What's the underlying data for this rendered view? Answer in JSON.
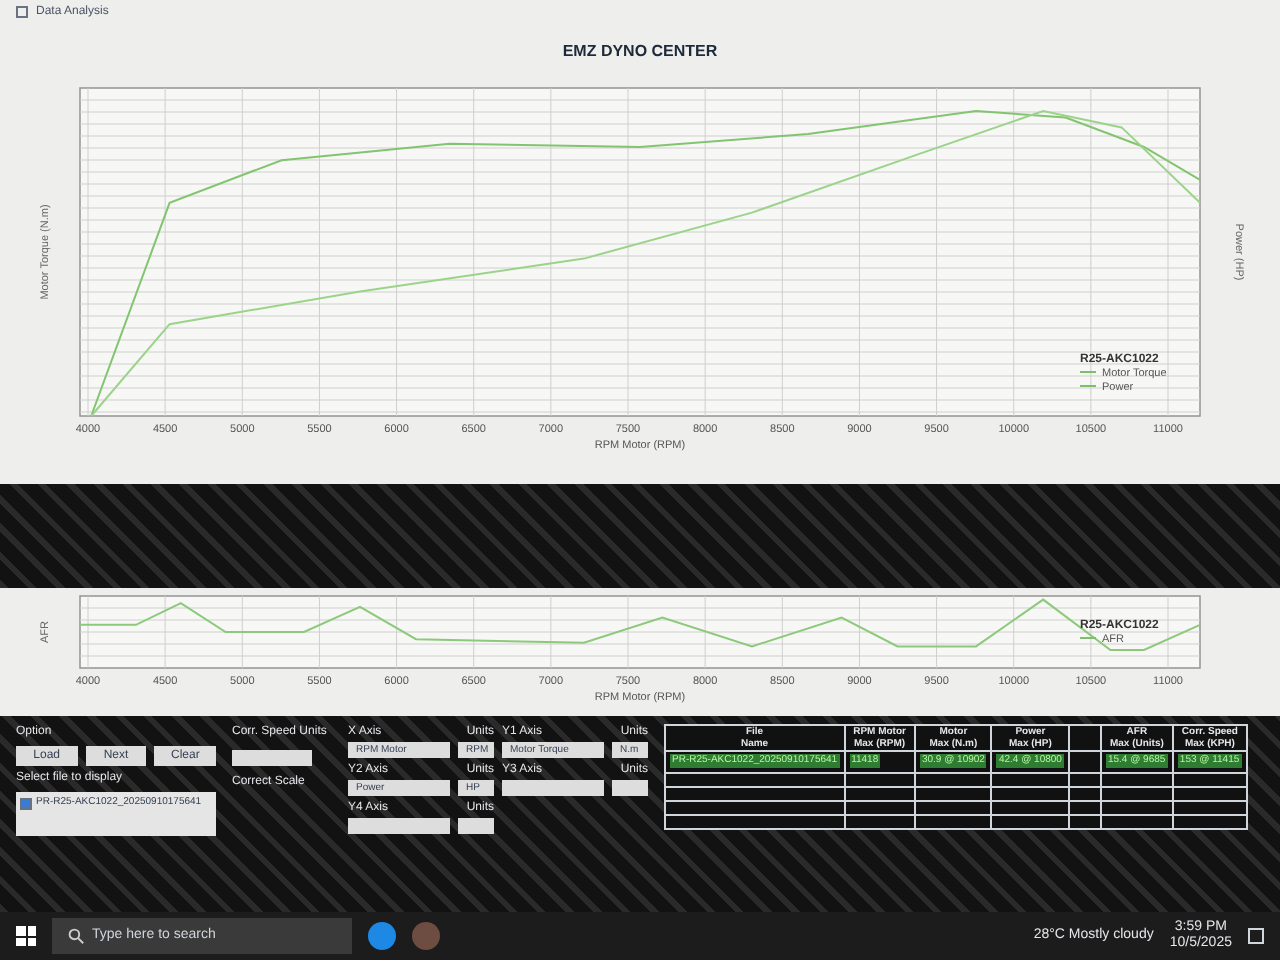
{
  "window": {
    "title": "Data Analysis"
  },
  "main_chart": {
    "title": "EMZ DYNO CENTER",
    "xlabel": "RPM Motor (RPM)",
    "y1label": "Motor Torque (N.m)",
    "y2label": "Power (HP)",
    "x_tick_labels": [
      "4000",
      "4500",
      "5000",
      "5500",
      "6000",
      "6500",
      "7000",
      "7500",
      "8000",
      "8500",
      "9000",
      "9500",
      "10000",
      "10500",
      "11000"
    ],
    "legend": {
      "title": "R25-AKC1022",
      "series": [
        "Motor Torque",
        "Power"
      ]
    }
  },
  "afr_chart": {
    "xlabel": "RPM Motor (RPM)",
    "ylabel": "AFR",
    "x_tick_labels": [
      "4000",
      "4500",
      "5000",
      "5500",
      "6000",
      "6500",
      "7000",
      "7500",
      "8000",
      "8500",
      "9000",
      "9500",
      "10000",
      "10500",
      "11000"
    ],
    "legend": {
      "title": "R25-AKC1022",
      "series": [
        "AFR"
      ]
    }
  },
  "options": {
    "label": "Option",
    "buttons": [
      "Load",
      "Next",
      "Clear"
    ],
    "file_list_label": "Select file to display",
    "files": [
      {
        "name": "PR-R25-AKC1022_20250910175641",
        "checked": true
      }
    ]
  },
  "axes": [
    {
      "label": "X Axis",
      "value": "RPM Motor",
      "units_label": "Units",
      "units": "RPM"
    },
    {
      "label": "Y1 Axis",
      "value": "Motor Torque",
      "units_label": "Units",
      "units": "N.m"
    },
    {
      "label": "Y2 Axis",
      "value": "Power",
      "units_label": "Units",
      "units": "HP"
    },
    {
      "label": "Y3 Axis",
      "units_label": "Units"
    },
    {
      "label": "Y4 Axis",
      "units_label": "Units"
    }
  ],
  "corr_speed_units_label": "Corr. Speed Units",
  "correct_scale_label": "Correct Scale",
  "table": {
    "columns": [
      {
        "top": "File",
        "bottom": "Name"
      },
      {
        "top": "RPM Motor",
        "bottom": "Max (RPM)"
      },
      {
        "top": "Motor",
        "bottom": "Max (N.m)"
      },
      {
        "top": "Power",
        "bottom": "Max (HP)"
      },
      null,
      {
        "top": "AFR",
        "bottom": "Max (Units)"
      },
      {
        "top": "Corr. Speed",
        "bottom": "Max (KPH)"
      }
    ],
    "rows": [
      [
        "PR-R25-AKC1022_20250910175641",
        "11418",
        "30.9 @ 10902",
        "42.4 @ 10800",
        null,
        "15.4 @ 9685",
        "153 @ 11415"
      ]
    ]
  },
  "taskbar": {
    "search_placeholder": "Type here to search",
    "weather": "28°C Mostly cloudy",
    "time": "3:59 PM",
    "date": "10/5/2025"
  }
}
